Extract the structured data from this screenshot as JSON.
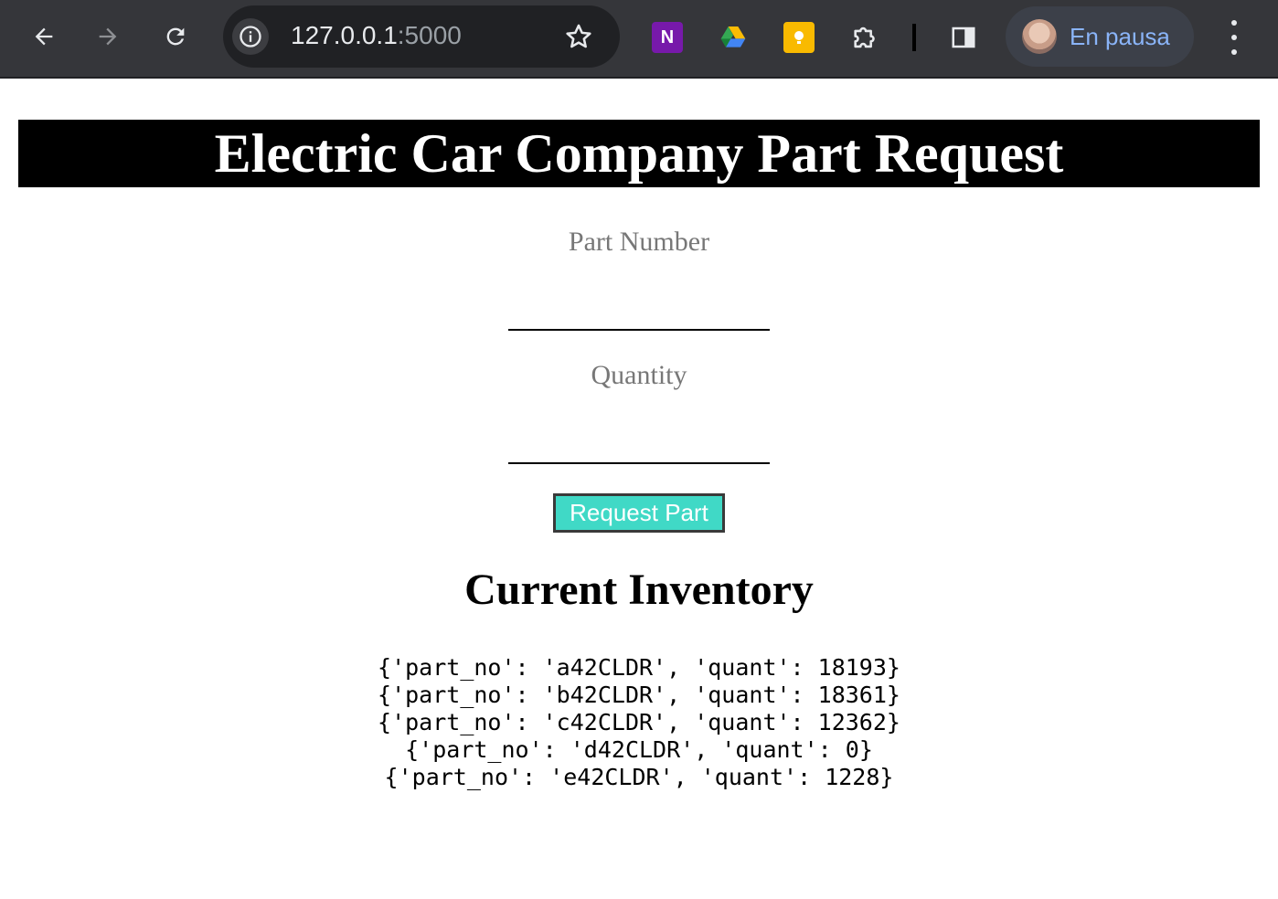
{
  "browser": {
    "url_host": "127.0.0.1",
    "url_port": ":5000",
    "profile_label": "En pausa",
    "icons": [
      "back-arrow-icon",
      "forward-arrow-icon",
      "reload-icon",
      "site-info-icon",
      "bookmark-star-icon",
      "onenote-icon",
      "google-drive-icon",
      "google-keep-icon",
      "extensions-puzzle-icon",
      "side-panel-icon",
      "avatar",
      "kebab-menu-icon"
    ]
  },
  "page": {
    "title": "Electric Car Company Part Request",
    "part_number_label": "Part Number",
    "part_number_value": "",
    "quantity_label": "Quantity",
    "quantity_value": "",
    "submit_label": "Request Part",
    "inventory_title": "Current Inventory",
    "inventory": [
      "{'part_no': 'a42CLDR', 'quant': 18193}",
      "{'part_no': 'b42CLDR', 'quant': 18361}",
      "{'part_no': 'c42CLDR', 'quant': 12362}",
      "{'part_no': 'd42CLDR', 'quant': 0}",
      "{'part_no': 'e42CLDR', 'quant': 1228}"
    ]
  },
  "colors": {
    "title_bar": "#000000",
    "button": "#40d9c6",
    "label_text": "#777777",
    "chrome_bg": "#35363a"
  }
}
